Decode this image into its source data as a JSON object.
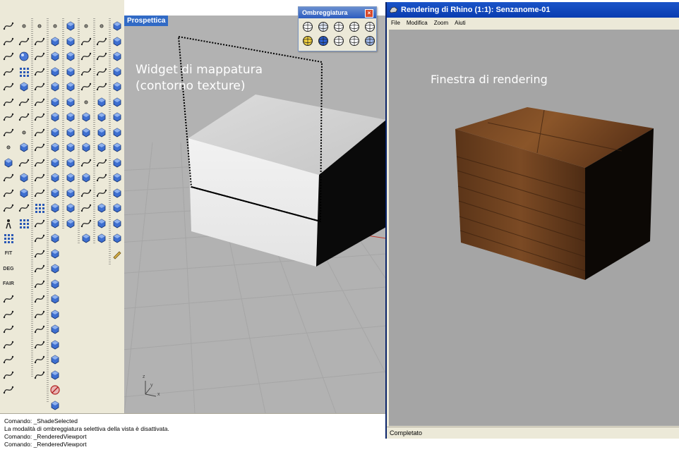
{
  "viewport": {
    "title": "Prospettica",
    "label_line1": "Widget di mappatura",
    "label_line2": "(contorno texture)",
    "axis": {
      "x": "x",
      "y": "y",
      "z": "z"
    }
  },
  "shading_toolbar": {
    "title": "Ombreggiatura",
    "close_glyph": "×",
    "buttons": [
      "wireframe-sphere-icon",
      "shaded-wire-sphere-icon",
      "ghosted-sphere-icon",
      "xray-sphere-icon",
      "shaded-sphere-icon",
      "rendered-sphere-icon",
      "blue-sphere-icon",
      "shaded-selected-icon",
      "flat-shade-icon",
      "multi-sphere-icon"
    ]
  },
  "render_window": {
    "title": "Rendering di Rhino (1:1): Senzanome-01",
    "menu": [
      "File",
      "Modifica",
      "Zoom",
      "Aiuti"
    ],
    "label": "Finestra di rendering",
    "status": "Completato"
  },
  "toolbar_text_buttons": {
    "fit": "FIT",
    "deg": "DEG",
    "fair": "FAIR"
  },
  "command_history": [
    "Comando: _ShadeSelected",
    "La modalità di ombreggiatura selettiva della vista è disattivata.",
    "Comando: _RenderedViewport",
    "Comando: _RenderedViewport"
  ],
  "colors": {
    "viewport_bg": "#b2b2b2",
    "render_bg": "#a5a5a5",
    "title_blue": "#316ac5",
    "wood": "#7a4a25"
  }
}
